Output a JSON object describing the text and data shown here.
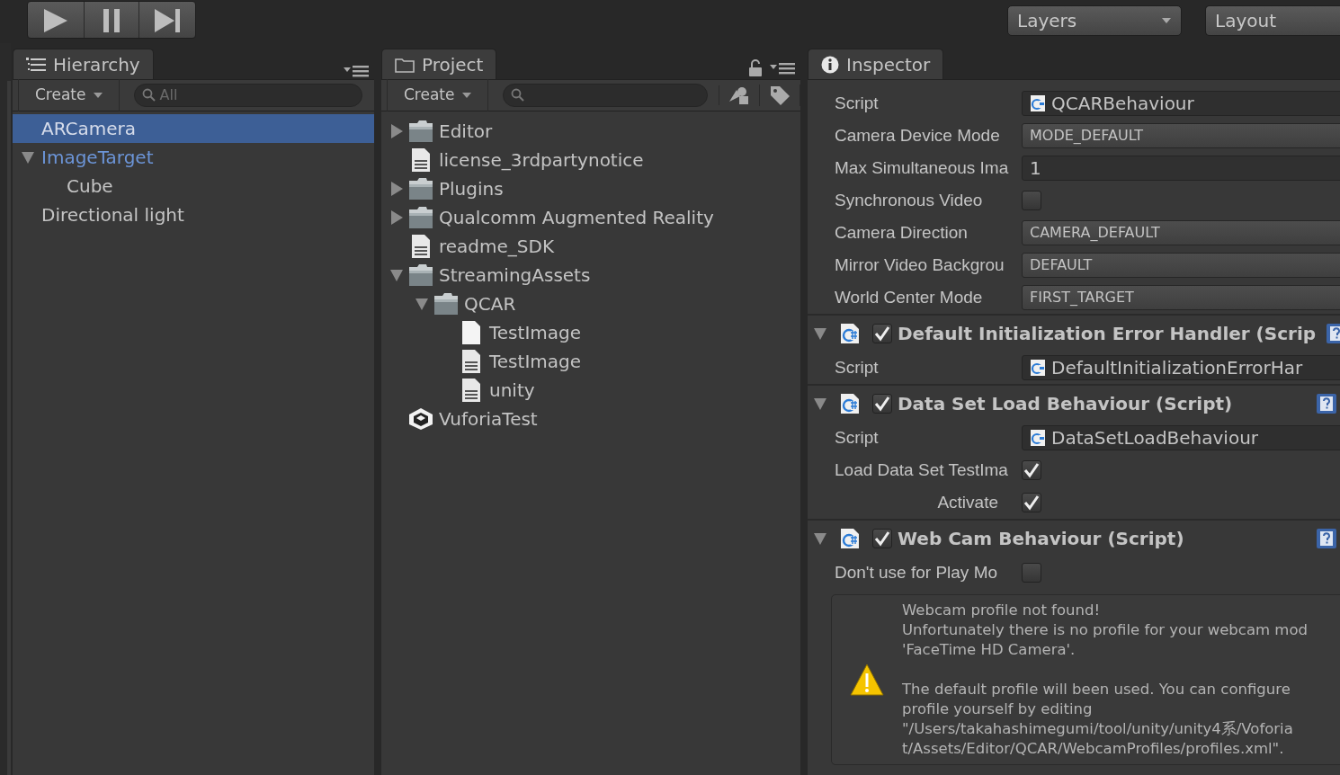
{
  "toolbar": {
    "layers": "Layers",
    "layout": "Layout"
  },
  "hierarchy": {
    "tab": "Hierarchy",
    "create": "Create",
    "search_placeholder": "All",
    "items": [
      {
        "label": "ARCamera",
        "kind": "object",
        "selected": true
      },
      {
        "label": "ImageTarget",
        "kind": "prefab",
        "selected": false,
        "expanded": true,
        "children": [
          {
            "label": "Cube",
            "kind": "object",
            "selected": false
          }
        ]
      },
      {
        "label": "Directional light",
        "kind": "object",
        "selected": false
      }
    ]
  },
  "project": {
    "tab": "Project",
    "create": "Create",
    "items": [
      {
        "label": "Editor",
        "kind": "folder",
        "expanded": false
      },
      {
        "label": "license_3rdpartynotice",
        "kind": "text"
      },
      {
        "label": "Plugins",
        "kind": "folder",
        "expanded": false
      },
      {
        "label": "Qualcomm Augmented Reality",
        "kind": "folder",
        "expanded": false
      },
      {
        "label": "readme_SDK",
        "kind": "text"
      },
      {
        "label": "StreamingAssets",
        "kind": "folder",
        "expanded": true,
        "children": [
          {
            "label": "QCAR",
            "kind": "folder",
            "expanded": true,
            "children": [
              {
                "label": "TestImage",
                "kind": "blank"
              },
              {
                "label": "TestImage",
                "kind": "text"
              },
              {
                "label": "unity",
                "kind": "text"
              }
            ]
          }
        ]
      },
      {
        "label": "VuforiaTest",
        "kind": "scene"
      }
    ]
  },
  "inspector": {
    "tab": "Inspector",
    "components": [
      {
        "fields": [
          {
            "label": "Script",
            "kind": "object",
            "value": "QCARBehaviour"
          },
          {
            "label": "Camera Device Mode",
            "kind": "dropdown",
            "value": "MODE_DEFAULT"
          },
          {
            "label": "Max Simultaneous Ima",
            "kind": "number",
            "value": "1"
          },
          {
            "label": "Synchronous Video",
            "kind": "checkbox",
            "checked": false
          },
          {
            "label": "Camera Direction",
            "kind": "dropdown",
            "value": "CAMERA_DEFAULT"
          },
          {
            "label": "Mirror Video Backgrou",
            "kind": "dropdown",
            "value": "DEFAULT"
          },
          {
            "label": "World Center Mode",
            "kind": "dropdown",
            "value": "FIRST_TARGET"
          }
        ]
      },
      {
        "title": "Default Initialization Error Handler (Scrip",
        "enabled": true,
        "expanded": true,
        "fields": [
          {
            "label": "Script",
            "kind": "object",
            "value": "DefaultInitializationErrorHar"
          }
        ]
      },
      {
        "title": "Data Set Load Behaviour (Script)",
        "enabled": true,
        "expanded": true,
        "fields": [
          {
            "label": "Script",
            "kind": "object",
            "value": "DataSetLoadBehaviour"
          },
          {
            "label": "Load Data Set TestIma",
            "kind": "checkbox",
            "checked": true
          },
          {
            "label": "Activate",
            "kind": "checkbox",
            "checked": true,
            "indent": true
          }
        ]
      },
      {
        "title": "Web Cam Behaviour (Script)",
        "enabled": true,
        "expanded": true,
        "fields": [
          {
            "label": "Don't use for Play Mo",
            "kind": "checkbox",
            "checked": false
          }
        ],
        "warning": [
          [
            "Webcam profile not found!",
            "Unfortunately there is no profile for your webcam mod",
            "'FaceTime HD Camera'."
          ],
          [
            "The default profile will been used. You can configure",
            "profile yourself by editing",
            "\"/Users/takahashimegumi/tool/unity/unity4系/Voforia",
            "t/Assets/Editor/QCAR/WebcamProfiles/profiles.xml\"."
          ]
        ]
      }
    ]
  }
}
